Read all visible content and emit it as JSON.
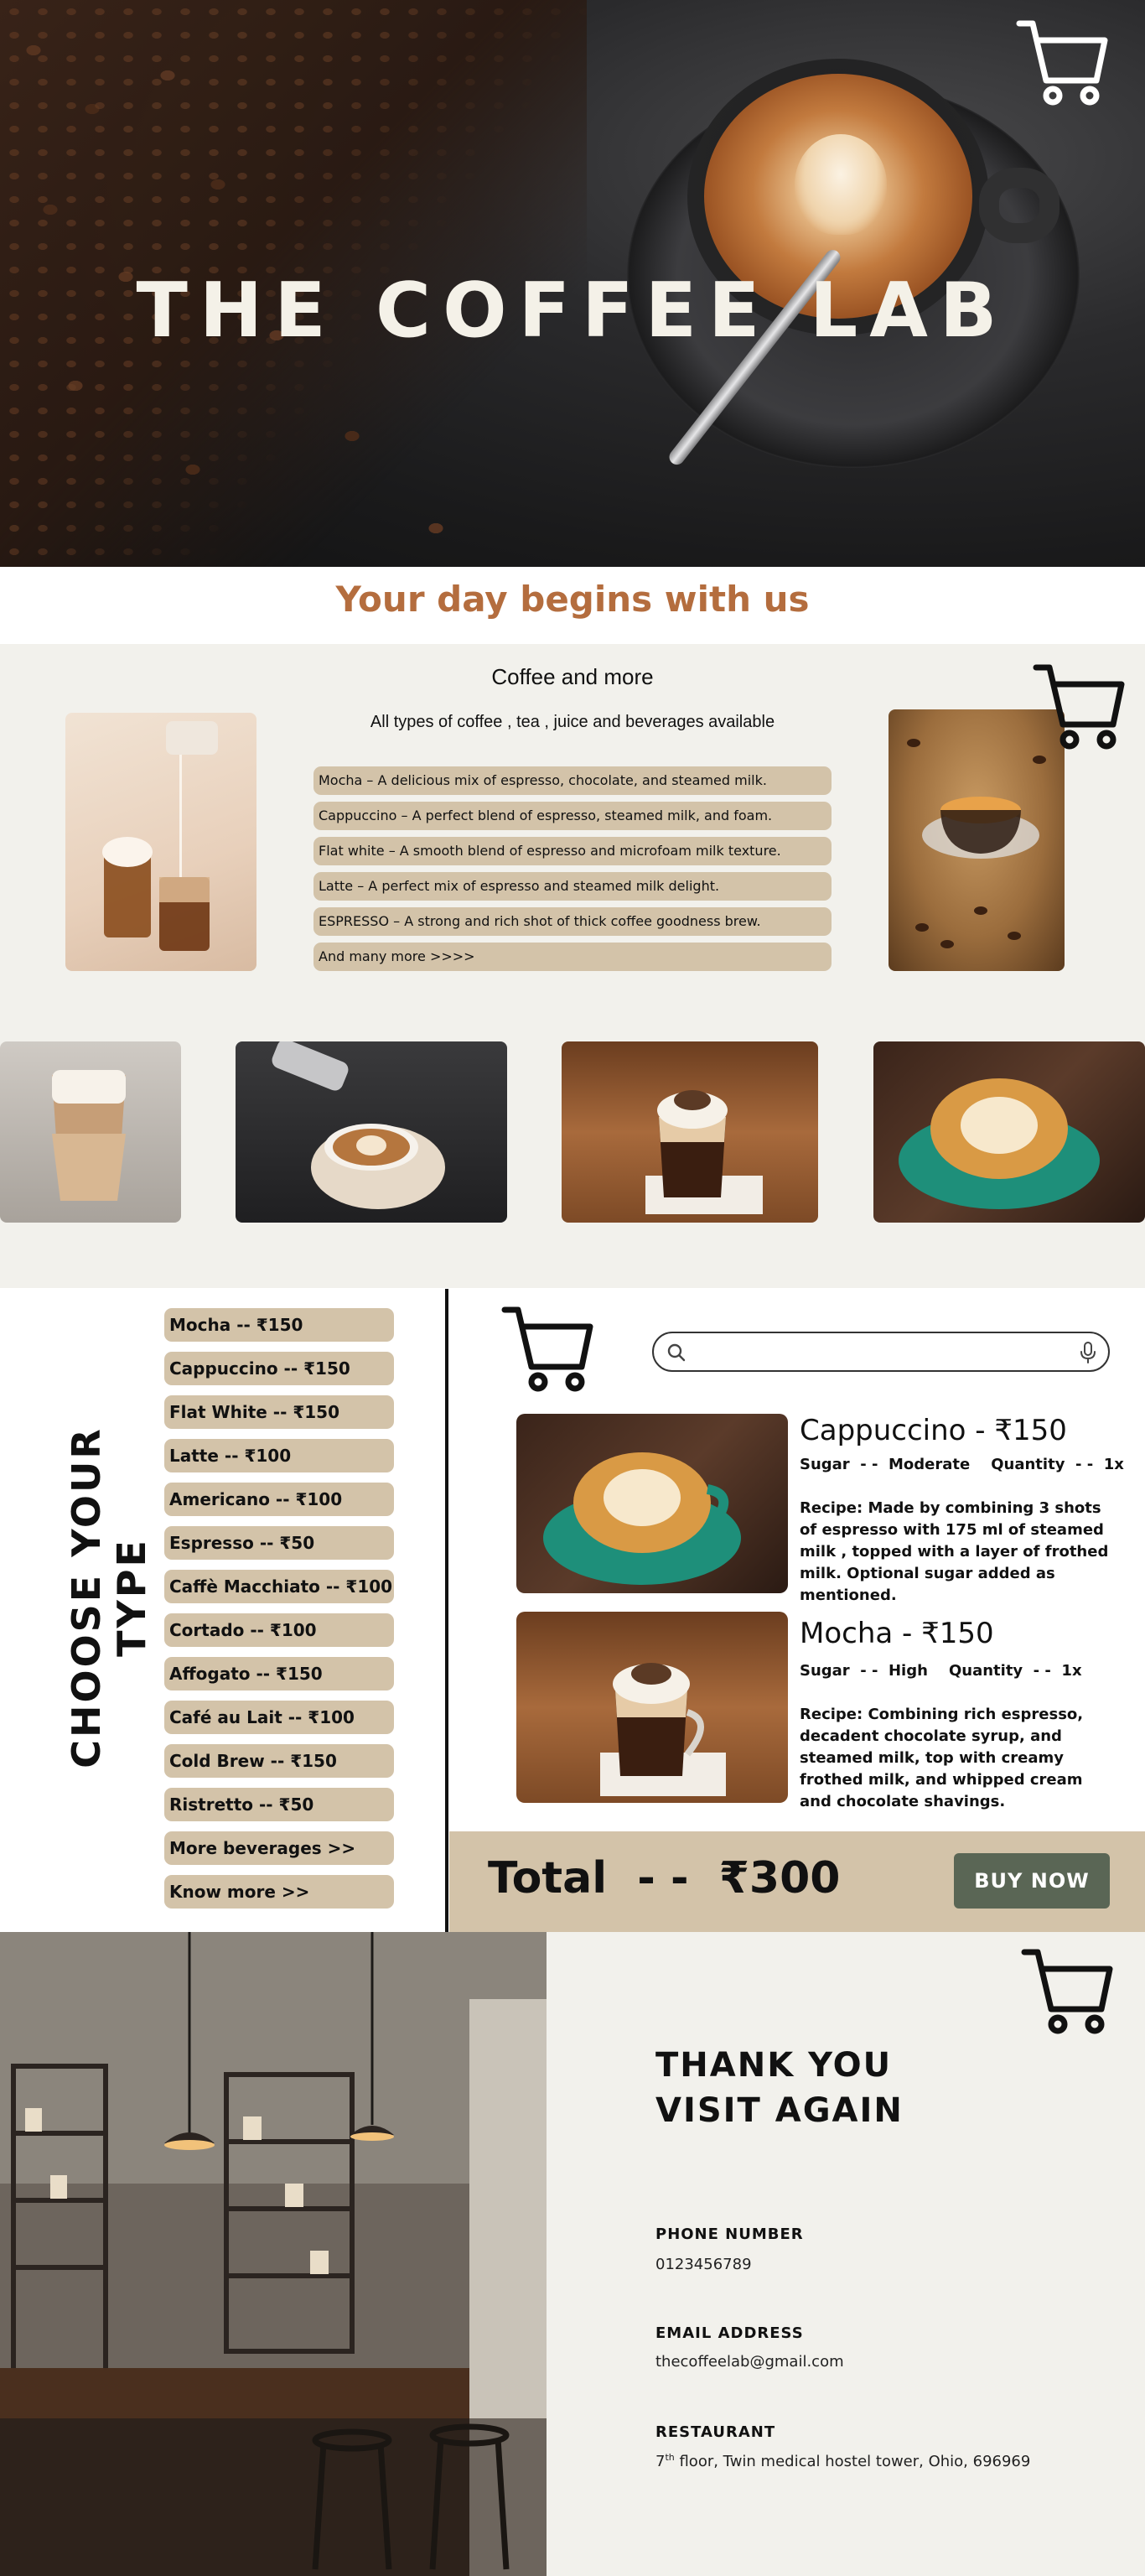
{
  "hero": {
    "title": "THE COFFEE LAB"
  },
  "tagline": "Your day begins with us",
  "intro": {
    "heading": "Coffee and more",
    "subheading": "All types of coffee , tea , juice and beverages available",
    "descriptions": [
      "Mocha  –  A delicious mix of espresso, chocolate, and steamed milk.",
      "Cappuccino  –  A perfect blend of espresso, steamed milk, and foam.",
      "Flat white  –  A smooth blend of espresso and microfoam milk texture.",
      "Latte  –  A perfect mix of espresso and steamed milk delight.",
      "ESPRESSO  –  A strong and rich shot of thick coffee goodness brew.",
      "And many more >>>>"
    ]
  },
  "choose": {
    "title": "CHOOSE YOUR TYPE",
    "types": [
      "Mocha -- ₹150",
      "Cappuccino -- ₹150",
      "Flat White -- ₹150",
      "Latte -- ₹100",
      "Americano -- ₹100",
      "Espresso -- ₹50",
      "Caffè Macchiato -- ₹100",
      "Cortado -- ₹100",
      "Affogato -- ₹150",
      "Café au Lait -- ₹100",
      "Cold Brew -- ₹150",
      "Ristretto -- ₹50",
      "More beverages >>",
      "Know more >>"
    ]
  },
  "search": {
    "value": "",
    "placeholder": ""
  },
  "cart_items": [
    {
      "title": "Cappuccino - ₹150",
      "meta": "Sugar  - -  Moderate    Quantity  - -  1x",
      "recipe": "Recipe: Made by combining 3 shots of espresso with 175 ml of steamed milk , topped with a layer of frothed milk. Optional sugar added as mentioned."
    },
    {
      "title": "Mocha - ₹150",
      "meta": "Sugar  - -  High    Quantity  - -  1x",
      "recipe": "Recipe: Combining rich espresso, decadent chocolate syrup, and steamed milk, top with creamy frothed milk, and whipped cream and chocolate shavings."
    }
  ],
  "total": {
    "text": "Total  - -  ₹300",
    "buy_label": "BUY NOW"
  },
  "footer": {
    "thanks_line1": "THANK YOU",
    "thanks_line2": "VISIT AGAIN",
    "phone_label": "PHONE NUMBER",
    "phone": "0123456789",
    "email_label": "EMAIL ADDRESS",
    "email": "thecoffeelab@gmail.com",
    "restaurant_label": "RESTAURANT",
    "floor_num": "7",
    "floor_sup": "th",
    "address_rest": " floor, Twin medical hostel tower, Ohio, 696969"
  },
  "colors": {
    "accent": "#b46d3e",
    "pill": "#d3c3a9",
    "buy_button": "#5a6655",
    "background": "#f2f1ec"
  },
  "icons": [
    "cart-icon",
    "search-icon",
    "mic-icon"
  ]
}
